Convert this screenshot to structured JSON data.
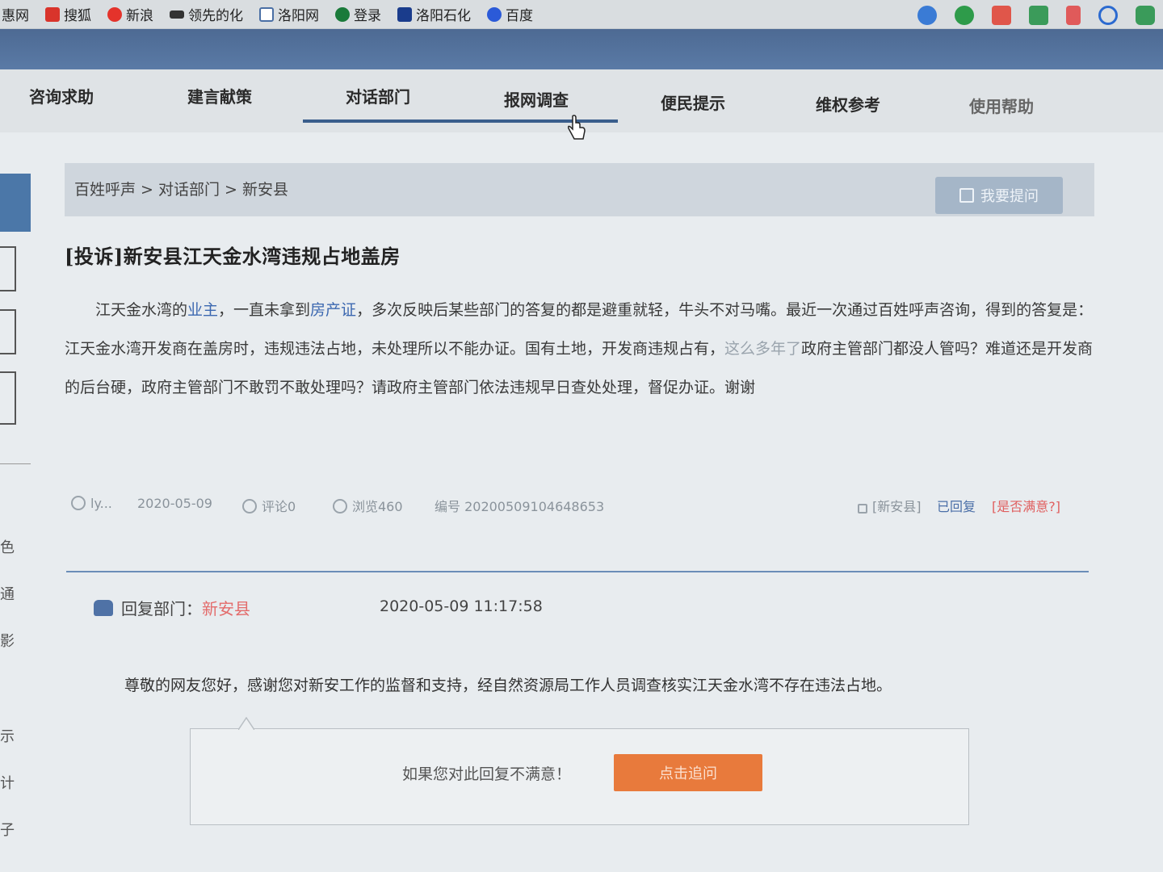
{
  "bookmarks": [
    {
      "label": "惠网",
      "color": "#ffffff"
    },
    {
      "label": "搜狐",
      "color": "#d9342b"
    },
    {
      "label": "新浪",
      "color": "#e4332b"
    },
    {
      "label": "领先的化",
      "color": "#333333"
    },
    {
      "label": "洛阳网",
      "color": "#4a6fa5"
    },
    {
      "label": "登录",
      "color": "#1a7a3a"
    },
    {
      "label": "洛阳石化",
      "color": "#1a3c8c"
    },
    {
      "label": "百度",
      "color": "#2b5ad8"
    }
  ],
  "toolbar_icons": [
    "minus-circle-icon",
    "green-app-icon",
    "calendar-icon",
    "spreadsheet-icon",
    "scissors-icon",
    "search-icon",
    "game-icon"
  ],
  "nav": {
    "items": [
      "咨询求助",
      "建言献策",
      "对话部门",
      "报网调查",
      "便民提示",
      "维权参考",
      "使用帮助"
    ],
    "active": "对话部门"
  },
  "sidebar": {
    "chars": [
      "色",
      "通",
      "影",
      "示",
      "计",
      "子"
    ]
  },
  "breadcrumb": "百姓呼声 > 对话部门 > 新安县",
  "ask_button": "我要提问",
  "post": {
    "title": "[投诉]新安县江天金水湾违规占地盖房",
    "body_parts": [
      "江天金水湾的",
      "业主",
      "，一直未拿到",
      "房产证",
      "，多次反映后某些部门的答复的都是避重就轻，牛头不对马嘴。最近一次",
      "通过百姓呼声咨询，得到的答复是：江天金水湾开发商在盖房时，违规违法占地，未处理所以不能办证。国有土地，开发商违规占有，",
      "这么多年了",
      "政府主管部门都没人管吗？难道还是开发商的后台硬，政府主管部门不敢罚不敢处理吗？请政府主管部门依法违规早日查处处理，督促办证。谢谢"
    ],
    "meta": {
      "author": "ly...",
      "date": "2020-05-09",
      "comments": "评论0",
      "views": "浏览460",
      "number": "编号 20200509104648653",
      "dept_tag": "[新安县]",
      "status": "已回复",
      "satisfied": "[是否满意?]"
    }
  },
  "reply": {
    "label": "回复部门：",
    "dept": "新安县",
    "time": "2020-05-09 11:17:58",
    "text": "尊敬的网友您好，感谢您对新安工作的监督和支持，经自然资源局工作人员调查核实江天金水湾不存在违法占地。"
  },
  "followup": {
    "prompt": "如果您对此回复不满意！",
    "button": "点击追问"
  },
  "colors": {
    "header": "#4d6a93",
    "accent": "#3a5e8c",
    "link": "#3c68b0",
    "dept_red": "#e36b6b",
    "followup_orange": "#e87a3c"
  }
}
